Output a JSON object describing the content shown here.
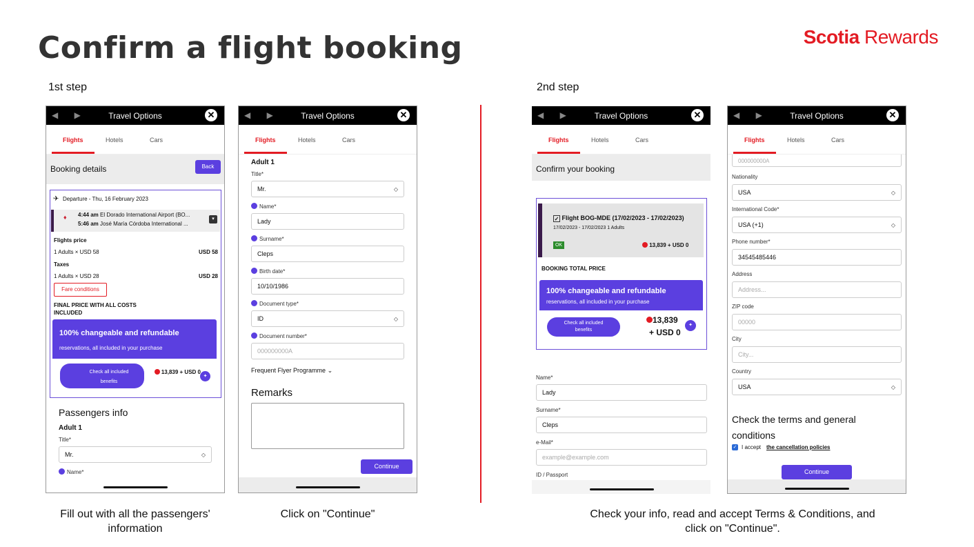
{
  "header": {
    "title": "Confirm a flight booking",
    "brand_bold": "Scotia",
    "brand_light": "Rewards"
  },
  "steps": {
    "s1": "1st step",
    "s2": "2nd step"
  },
  "captions": {
    "c1": "Fill out with all the passengers' information",
    "c2": "Click on \"Continue\"",
    "c3": "Check your info, read and accept Terms & Conditions, and click on \"Continue\"."
  },
  "app": {
    "title": "Travel Options",
    "nav": "◀ ▶",
    "close": "✕",
    "tabs": [
      "Flights",
      "Hotels",
      "Cars"
    ]
  },
  "p1": {
    "heading": "Booking details",
    "back": "Back",
    "departure": "Departure - Thu, 16 February 2023",
    "dep_time": "4:44 am",
    "dep_place": "El Dorado International Airport (BO...",
    "arr_time": "5:46 am",
    "arr_place": "José María Córdoba International ...",
    "flights_price": "Flights price",
    "fp_row": "1 Adults × USD 58",
    "fp_val": "USD 58",
    "taxes": "Taxes",
    "tx_row": "1 Adults × USD 28",
    "tx_val": "USD 28",
    "fare": "Fare conditions",
    "final": "FINAL PRICE WITH ALL COSTS INCLUDED",
    "promo_title": "100% changeable and refundable",
    "promo_sub": "reservations, all included in your purchase",
    "benefits": "Check all included benefits",
    "price": "13,839 + USD 0",
    "pass_info": "Passengers info",
    "adult": "Adult 1",
    "title_lbl": "Title*",
    "title_val": "Mr.",
    "name_lbl": "Name*"
  },
  "p2": {
    "adult": "Adult 1",
    "title_lbl": "Title*",
    "title_val": "Mr.",
    "name_lbl": "Name*",
    "name_val": "Lady",
    "surname_lbl": "Surname*",
    "surname_val": "Cleps",
    "birth_lbl": "Birth date*",
    "birth_val": "10/10/1986",
    "doc_lbl": "Document type*",
    "doc_val": "ID",
    "docnum_lbl": "Document number*",
    "docnum_ph": "000000000A",
    "ffp": "Frequent Flyer Programme",
    "remarks": "Remarks",
    "continue": "Continue"
  },
  "p3": {
    "heading": "Confirm your booking",
    "flight": "Flight BOG-MDE (17/02/2023 - 17/02/2023)",
    "flight_sub": "17/02/2023 - 17/02/2023 1 Adults",
    "ok": "OK",
    "flight_price": "13,839 + USD 0",
    "total": "BOOKING TOTAL PRICE",
    "promo_title": "100% changeable and refundable",
    "promo_sub": "reservations, all included in your purchase",
    "benefits": "Check all included benefits",
    "price_a": "13,839",
    "price_b": "+ USD 0",
    "name_lbl": "Name*",
    "name_val": "Lady",
    "surname_lbl": "Surname*",
    "surname_val": "Cleps",
    "email_lbl": "e-Mail*",
    "email_ph": "example@example.com",
    "id_lbl": "ID / Passport"
  },
  "p4": {
    "docnum": "000000000A",
    "nat_lbl": "Nationality",
    "nat_val": "USA",
    "code_lbl": "International Code*",
    "code_val": "USA (+1)",
    "phone_lbl": "Phone number*",
    "phone_val": "34545485446",
    "addr_lbl": "Address",
    "addr_ph": "Address...",
    "zip_lbl": "ZIP code",
    "zip_ph": "00000",
    "city_lbl": "City",
    "city_ph": "City...",
    "country_lbl": "Country",
    "country_val": "USA",
    "terms": "Check the terms and general conditions",
    "accept": "I accept",
    "policies": "the cancellation policies",
    "continue": "Continue"
  },
  "colors": {
    "brand": "#e31b23",
    "accent": "#5b3fe0"
  }
}
